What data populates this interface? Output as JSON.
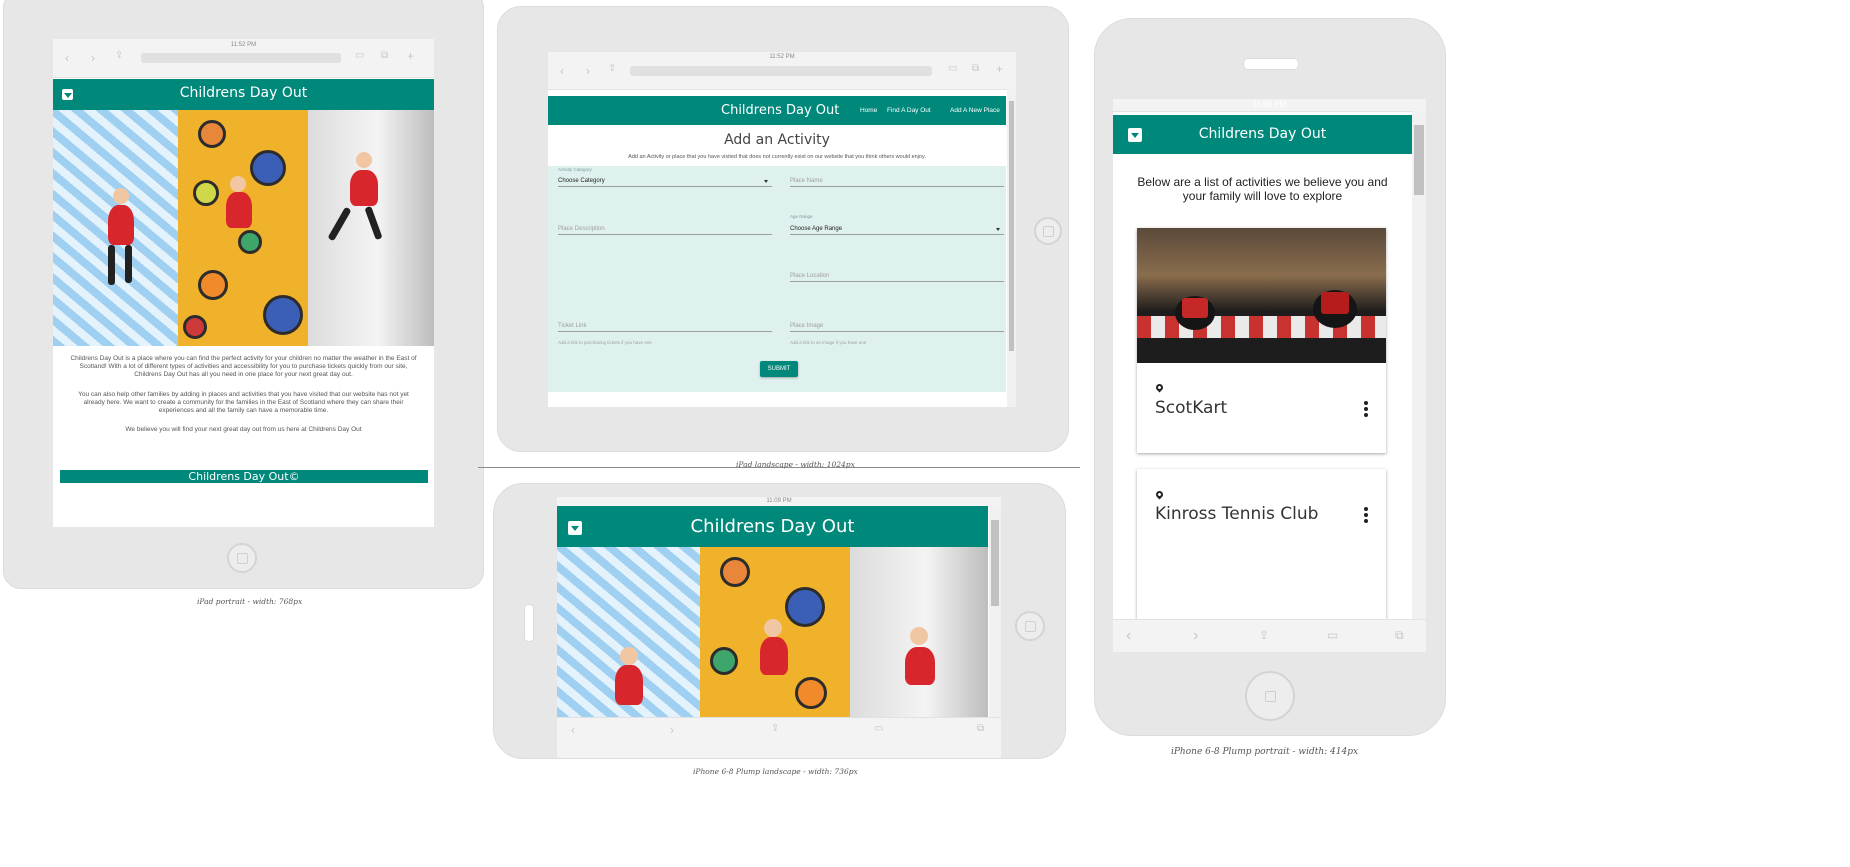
{
  "brand": {
    "title": "Childrens Day Out",
    "accent": "#00897b"
  },
  "captions": {
    "ipad_portrait": "iPad portrait - width: 768px",
    "ipad_landscape": "iPad landscape - width: 1024px",
    "iphone_landscape": "iPhone 6-8 Plump landscape - width: 736px",
    "iphone_portrait": "iPhone 6-8 Plump portrait - width: 414px"
  },
  "clock": {
    "ipad_portrait": "11:52 PM",
    "ipad_landscape": "11:52 PM",
    "iphone_landscape": "11:09 PM",
    "iphone_portrait": "11:09 PM"
  },
  "icons": {
    "back": "chevron-left-icon",
    "forward": "chevron-right-icon",
    "share": "share-icon",
    "bookmarks": "book-icon",
    "tabs": "tabs-icon",
    "new_tab": "plus-icon",
    "location": "map-pin-icon",
    "menu": "more-vert-icon"
  },
  "portrait_page": {
    "paragraphs": [
      "Childrens Day Out is a place where you can find the perfect activity for your children no matter the weather in the East of Scotland! With a lot of different types of activities and accessibility for you to purchase tickets quickly from our site, Childrens Day Out has all you need in one place for your next great day out.",
      "You can also help other families by adding in places and activities that you have visited that our website has not yet already here. We want to create a community for the families in the East of Scotland where they can share their experiences and all the family can have a memorable time.",
      "We believe you will find your next great day out from us here at Childrens Day Out"
    ],
    "footer": "Childrens Day Out©"
  },
  "landscape_page": {
    "nav": {
      "home": "Home",
      "find": "Find A Day Out",
      "add": "Add A New Place"
    },
    "heading": "Add an Activity",
    "subheading": "Add an Activity or place that you have visited that does not currently exist on our website that you think others would enjoy.",
    "form": {
      "category_label": "Activity Category",
      "category_value": "Choose Category",
      "name_placeholder": "Place Name",
      "description_placeholder": "Place Description",
      "age_label": "Age Range",
      "age_value": "Choose Age Range",
      "location_placeholder": "Place Location",
      "ticket_placeholder": "Ticket Link",
      "ticket_help": "Add a link to purchasing tickets if you have one",
      "image_placeholder": "Place Image",
      "image_help": "Add a link to an image if you have one",
      "submit": "SUBMIT"
    }
  },
  "phone_page": {
    "intro": "Below are a list of activities we believe you and your family will love to explore",
    "cards": [
      {
        "name": "ScotKart"
      },
      {
        "name": "Kinross Tennis Club"
      }
    ]
  }
}
